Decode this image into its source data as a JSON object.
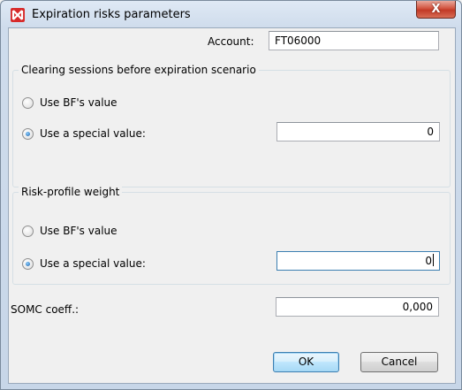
{
  "window": {
    "title": "Expiration risks parameters",
    "close_glyph": "X"
  },
  "account": {
    "label": "Account:",
    "value": "FT06000"
  },
  "clearing_sessions": {
    "group_title": "Clearing sessions before expiration scenario",
    "option_bf": "Use BF's value",
    "option_special": "Use a special value:",
    "selected": "special",
    "value": "0"
  },
  "risk_profile": {
    "group_title": "Risk-profile weight",
    "option_bf": "Use BF's value",
    "option_special": "Use a special value:",
    "selected": "special",
    "value": "0"
  },
  "somc": {
    "label": "SOMC coeff.:",
    "value": "0,000"
  },
  "buttons": {
    "ok": "OK",
    "cancel": "Cancel"
  },
  "colors": {
    "app_icon": "#d72a2a",
    "close_button": "#c23a26",
    "focus_border": "#3c7fb1"
  },
  "icons": {
    "app": "app-logo-icon",
    "close": "close-icon",
    "cursor": "mouse-cursor-icon"
  }
}
